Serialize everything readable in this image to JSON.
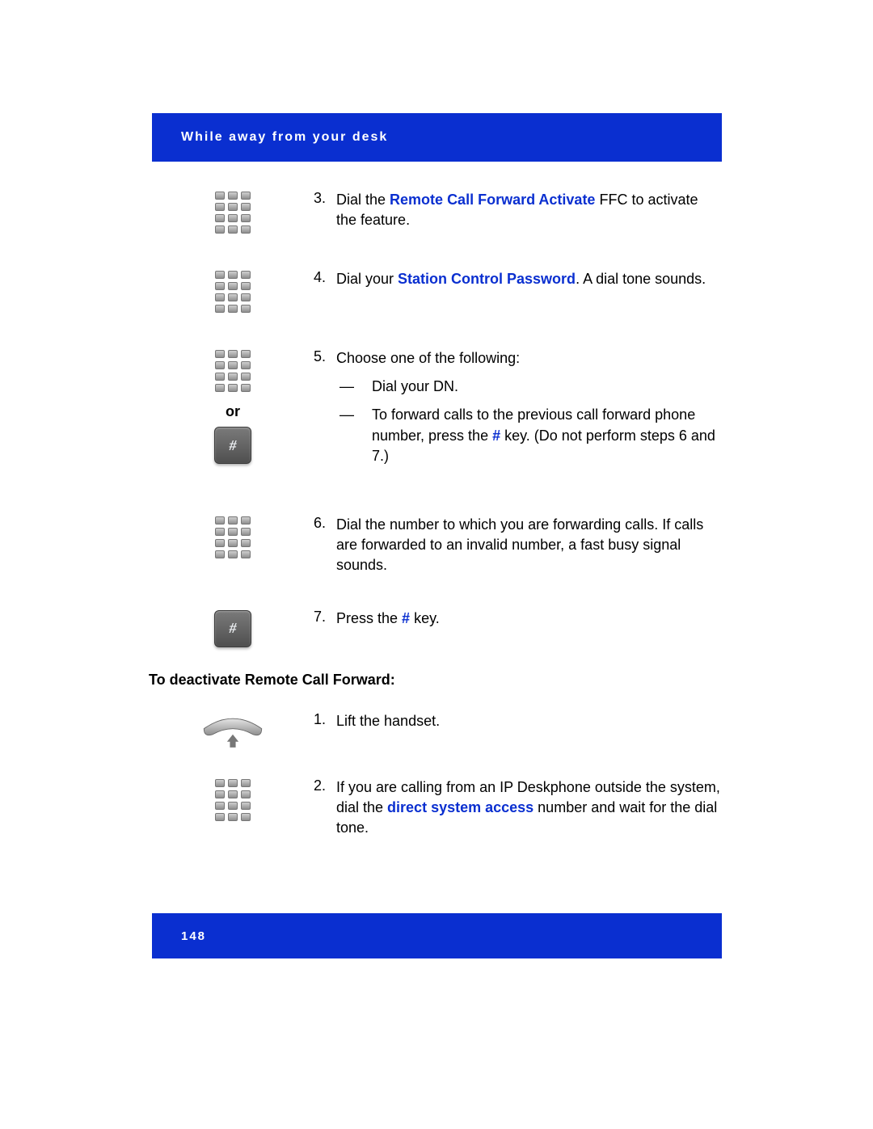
{
  "header": {
    "title": "While away from your desk"
  },
  "footer": {
    "page_number": "148"
  },
  "or_label": "or",
  "steps_a": [
    {
      "n": "3.",
      "pre": "Dial the ",
      "hl": "Remote Call Forward Activate",
      "post": " FFC to activate the feature."
    },
    {
      "n": "4.",
      "pre": "Dial your ",
      "hl": "Station Control Password",
      "post": ". A dial tone sounds."
    }
  ],
  "step5": {
    "n": "5.",
    "intro": "Choose one of the following:",
    "sub": [
      {
        "text": "Dial your DN."
      },
      {
        "pre": "To forward calls to the previous call forward phone number, press the ",
        "hl": "#",
        "post": " key. (Do not perform steps 6 and 7.)"
      }
    ]
  },
  "step6": {
    "n": "6.",
    "text": "Dial the number to which you are forwarding calls. If calls are forwarded to an invalid number, a fast busy signal sounds."
  },
  "step7": {
    "n": "7.",
    "pre": "Press the ",
    "hl": "#",
    "post": " key."
  },
  "section2": {
    "heading": "To deactivate Remote Call Forward:"
  },
  "stepB1": {
    "n": "1.",
    "text": "Lift the handset."
  },
  "stepB2": {
    "n": "2.",
    "pre": "If you are calling from an IP Deskphone outside the system, dial the ",
    "hl": "direct system access",
    "post": " number and wait for the dial tone."
  }
}
